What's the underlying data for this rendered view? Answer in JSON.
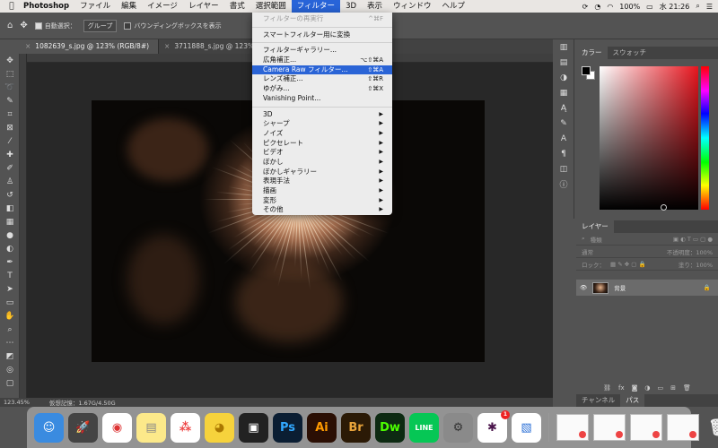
{
  "menubar": {
    "app": "Photoshop",
    "items": [
      "ファイル",
      "編集",
      "イメージ",
      "レイヤー",
      "書式",
      "選択範囲",
      "フィルター",
      "3D",
      "表示",
      "ウィンドウ",
      "ヘルプ"
    ],
    "active_index": 6,
    "battery": "100%",
    "time": "水 21:26"
  },
  "options": {
    "auto_select_label": "自動選択：",
    "group_select": "グループ",
    "bounding_box_label": "バウンディングボックスを表示"
  },
  "tabs": [
    {
      "label": "1082639_s.jpg @ 123% (RGB/8#)",
      "active": true
    },
    {
      "label": "3711888_s.jpg @ 123% (RGB/8#)",
      "active": false
    }
  ],
  "status": {
    "zoom": "123.45%",
    "memory": "仮想記憶：1.67G/4.50G"
  },
  "panels": {
    "color_tab": "カラー",
    "swatch_tab": "スウォッチ",
    "layers_tab": "レイヤー",
    "layer_search": "種類",
    "blend_mode": "通常",
    "opacity_label": "不透明度：100%",
    "lock_label": "ロック：",
    "fill_label": "塗り：100%",
    "layer_name": "背景",
    "channels_tab": "チャンネル",
    "paths_tab": "パス"
  },
  "filter_menu": {
    "items": [
      {
        "label": "フィルターの再実行",
        "shortcut": "^⌘F",
        "disabled": true
      },
      {
        "sep": true
      },
      {
        "label": "スマートフィルター用に変換"
      },
      {
        "sep": true
      },
      {
        "label": "フィルターギャラリー..."
      },
      {
        "label": "広角補正...",
        "shortcut": "⌥⇧⌘A"
      },
      {
        "label": "Camera Raw フィルター...",
        "shortcut": "⇧⌘A",
        "highlighted": true
      },
      {
        "label": "レンズ補正...",
        "shortcut": "⇧⌘R"
      },
      {
        "label": "ゆがみ...",
        "shortcut": "⇧⌘X"
      },
      {
        "label": "Vanishing Point..."
      },
      {
        "sep": true
      },
      {
        "label": "3D",
        "submenu": true
      },
      {
        "label": "シャープ",
        "submenu": true
      },
      {
        "label": "ノイズ",
        "submenu": true
      },
      {
        "label": "ピクセレート",
        "submenu": true
      },
      {
        "label": "ビデオ",
        "submenu": true
      },
      {
        "label": "ぼかし",
        "submenu": true
      },
      {
        "label": "ぼかしギャラリー",
        "submenu": true
      },
      {
        "label": "表現手法",
        "submenu": true
      },
      {
        "label": "描画",
        "submenu": true
      },
      {
        "label": "変形",
        "submenu": true
      },
      {
        "label": "その他",
        "submenu": true
      }
    ]
  },
  "dock": {
    "icons": [
      {
        "name": "finder-icon",
        "glyph": "☺",
        "bg": "#3a8be0",
        "fg": "#fff"
      },
      {
        "name": "launchpad-icon",
        "glyph": "🚀",
        "bg": "#444",
        "fg": "#fff"
      },
      {
        "name": "chrome-icon",
        "glyph": "◉",
        "bg": "#fff",
        "fg": "#d33"
      },
      {
        "name": "notes-icon",
        "glyph": "▤",
        "bg": "#fce98a",
        "fg": "#888"
      },
      {
        "name": "asana-icon",
        "glyph": "⁂",
        "bg": "#fff",
        "fg": "#e44"
      },
      {
        "name": "cyberduck-icon",
        "glyph": "◕",
        "bg": "#f6d23c",
        "fg": "#a70"
      },
      {
        "name": "remote-desktop-icon",
        "glyph": "▣",
        "bg": "#222",
        "fg": "#fff"
      },
      {
        "name": "photoshop-icon",
        "glyph": "Ps",
        "bg": "#0b1e33",
        "fg": "#31a8ff"
      },
      {
        "name": "illustrator-icon",
        "glyph": "Ai",
        "bg": "#2b0f04",
        "fg": "#ff9a00"
      },
      {
        "name": "bridge-icon",
        "glyph": "Br",
        "bg": "#2b1a06",
        "fg": "#e8a33a"
      },
      {
        "name": "dreamweaver-icon",
        "glyph": "Dw",
        "bg": "#0d2a12",
        "fg": "#4cff00"
      },
      {
        "name": "line-icon",
        "glyph": "LINE",
        "bg": "#06c755",
        "fg": "#fff"
      },
      {
        "name": "system-preferences-icon",
        "glyph": "⚙",
        "bg": "#8a8a8a",
        "fg": "#333"
      },
      {
        "name": "slack-icon",
        "glyph": "✱",
        "bg": "#fff",
        "fg": "#4a154b",
        "badge": "1"
      },
      {
        "name": "preview-icon",
        "glyph": "▧",
        "bg": "#fff",
        "fg": "#2a6fd6"
      }
    ]
  }
}
